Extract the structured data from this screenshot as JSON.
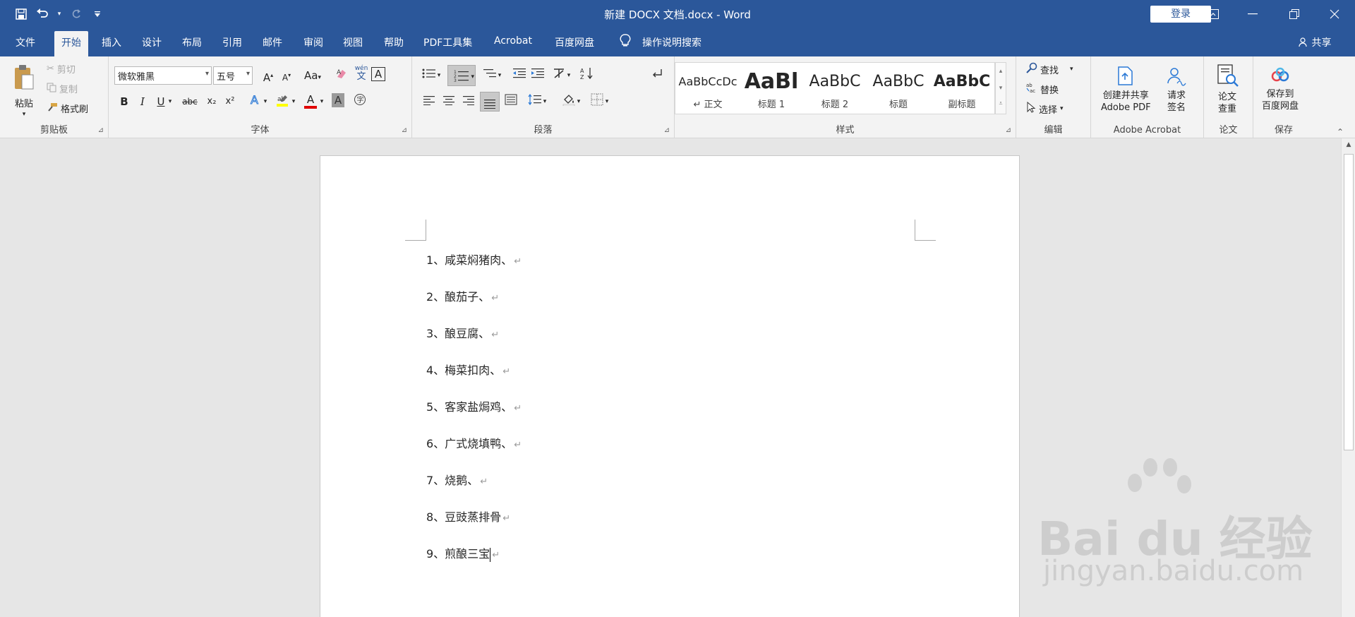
{
  "window": {
    "title": "新建 DOCX 文档.docx  -  Word",
    "login_label": "登录",
    "qat_more": "₹"
  },
  "tabs": [
    "文件",
    "开始",
    "插入",
    "设计",
    "布局",
    "引用",
    "邮件",
    "审阅",
    "视图",
    "帮助",
    "PDF工具集",
    "Acrobat",
    "百度网盘"
  ],
  "active_tab": "开始",
  "tell_me": "操作说明搜索",
  "share_label": "共享",
  "ribbon": {
    "clipboard": {
      "label": "剪贴板",
      "paste": "粘贴",
      "cut": "剪切",
      "copy": "复制",
      "format_painter": "格式刷"
    },
    "font": {
      "label": "字体",
      "font_name": "微软雅黑",
      "font_size": "五号",
      "bold": "B",
      "italic": "I",
      "underline": "U",
      "strike": "abc",
      "subscript": "x₂",
      "superscript": "x²",
      "grow": "A",
      "shrink": "A",
      "case": "Aa",
      "wen": "wén",
      "wen_char": "文",
      "boxed": "A",
      "font_color": "A",
      "char_shade": "A"
    },
    "paragraph": {
      "label": "段落"
    },
    "styles": {
      "label": "样式",
      "items": [
        {
          "sample": "AaBbCcDc",
          "name": "↵ 正文"
        },
        {
          "sample": "AaBl",
          "name": "标题 1"
        },
        {
          "sample": "AaBbC",
          "name": "标题 2"
        },
        {
          "sample": "AaBbC",
          "name": "标题"
        },
        {
          "sample": "AaBbC",
          "name": "副标题"
        }
      ]
    },
    "editing": {
      "label": "编辑",
      "find": "查找",
      "replace": "替换",
      "select": "选择"
    },
    "acrobat": {
      "label": "Adobe Acrobat",
      "create_share_1": "创建并共享",
      "create_share_2": "Adobe PDF",
      "request_sign_1": "请求",
      "request_sign_2": "签名"
    },
    "thesis": {
      "label": "论文",
      "check_1": "论文",
      "check_2": "查重"
    },
    "save": {
      "label": "保存",
      "baidu_1": "保存到",
      "baidu_2": "百度网盘"
    }
  },
  "document": {
    "items": [
      "1、咸菜焖猪肉、",
      "2、酿茄子、",
      "3、酿豆腐、",
      "4、梅菜扣肉、",
      "5、客家盐焗鸡、",
      "6、广式烧填鸭、",
      "7、烧鹅、",
      "8、豆豉蒸排骨",
      "9、煎酿三宝"
    ],
    "return_mark": "↵"
  },
  "watermark": {
    "brand": "Bai  du 经验",
    "url": "jingyan.baidu.com"
  },
  "colors": {
    "titlebar": "#2b579a",
    "ribbon": "#f3f3f3",
    "font_color_bar": "#e00000",
    "highlight_bar": "#ffff00"
  }
}
